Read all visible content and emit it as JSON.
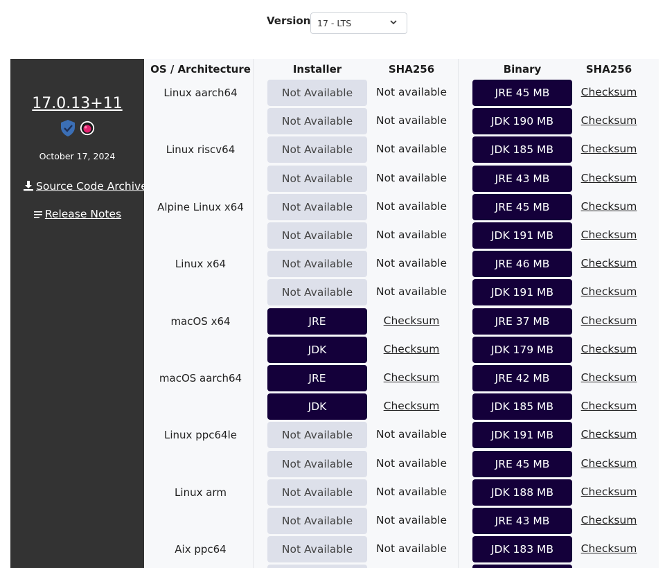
{
  "version_selector": {
    "label": "Version",
    "selected": "17 - LTS"
  },
  "release": {
    "version": "17.0.13+11",
    "date": "October 17, 2024",
    "source_link": "Source Code Archive",
    "notes_link": "Release Notes",
    "badges": [
      "shield-check-icon",
      "aqavit-icon"
    ]
  },
  "headers": {
    "os": "OS / Architecture",
    "installer": "Installer",
    "installer_sha": "SHA256",
    "binary": "Binary",
    "binary_sha": "SHA256"
  },
  "rows": [
    {
      "os": "Linux aarch64",
      "installer": "Not Available",
      "installer_available": false,
      "installer_sha": "Not available",
      "binary": "JRE 45 MB",
      "binary_sha": "Checksum"
    },
    {
      "os": "",
      "installer": "Not Available",
      "installer_available": false,
      "installer_sha": "Not available",
      "binary": "JDK 190 MB",
      "binary_sha": "Checksum"
    },
    {
      "os": "Linux riscv64",
      "installer": "Not Available",
      "installer_available": false,
      "installer_sha": "Not available",
      "binary": "JDK 185 MB",
      "binary_sha": "Checksum"
    },
    {
      "os": "",
      "installer": "Not Available",
      "installer_available": false,
      "installer_sha": "Not available",
      "binary": "JRE 43 MB",
      "binary_sha": "Checksum"
    },
    {
      "os": "Alpine Linux x64",
      "installer": "Not Available",
      "installer_available": false,
      "installer_sha": "Not available",
      "binary": "JRE 45 MB",
      "binary_sha": "Checksum"
    },
    {
      "os": "",
      "installer": "Not Available",
      "installer_available": false,
      "installer_sha": "Not available",
      "binary": "JDK 191 MB",
      "binary_sha": "Checksum"
    },
    {
      "os": "Linux x64",
      "installer": "Not Available",
      "installer_available": false,
      "installer_sha": "Not available",
      "binary": "JRE 46 MB",
      "binary_sha": "Checksum"
    },
    {
      "os": "",
      "installer": "Not Available",
      "installer_available": false,
      "installer_sha": "Not available",
      "binary": "JDK 191 MB",
      "binary_sha": "Checksum"
    },
    {
      "os": "macOS x64",
      "installer": "JRE",
      "installer_available": true,
      "installer_sha": "Checksum",
      "binary": "JRE 37 MB",
      "binary_sha": "Checksum"
    },
    {
      "os": "",
      "installer": "JDK",
      "installer_available": true,
      "installer_sha": "Checksum",
      "binary": "JDK 179 MB",
      "binary_sha": "Checksum"
    },
    {
      "os": "macOS aarch64",
      "installer": "JRE",
      "installer_available": true,
      "installer_sha": "Checksum",
      "binary": "JRE 42 MB",
      "binary_sha": "Checksum"
    },
    {
      "os": "",
      "installer": "JDK",
      "installer_available": true,
      "installer_sha": "Checksum",
      "binary": "JDK 185 MB",
      "binary_sha": "Checksum"
    },
    {
      "os": "Linux ppc64le",
      "installer": "Not Available",
      "installer_available": false,
      "installer_sha": "Not available",
      "binary": "JDK 191 MB",
      "binary_sha": "Checksum"
    },
    {
      "os": "",
      "installer": "Not Available",
      "installer_available": false,
      "installer_sha": "Not available",
      "binary": "JRE 45 MB",
      "binary_sha": "Checksum"
    },
    {
      "os": "Linux arm",
      "installer": "Not Available",
      "installer_available": false,
      "installer_sha": "Not available",
      "binary": "JDK 188 MB",
      "binary_sha": "Checksum"
    },
    {
      "os": "",
      "installer": "Not Available",
      "installer_available": false,
      "installer_sha": "Not available",
      "binary": "JRE 43 MB",
      "binary_sha": "Checksum"
    },
    {
      "os": "Aix ppc64",
      "installer": "Not Available",
      "installer_available": false,
      "installer_sha": "Not available",
      "binary": "JDK 183 MB",
      "binary_sha": "Checksum"
    },
    {
      "os": "",
      "installer": "",
      "installer_available": false,
      "installer_sha": "",
      "binary": "",
      "binary_sha": ""
    }
  ],
  "colors": {
    "panel_bg": "#333333",
    "table_bg": "#f7f8fa",
    "dark_button": "#14003a",
    "na_button": "#dde0ea",
    "badge_blue": "#3b6fb6",
    "badge_pink": "#e0226e"
  }
}
